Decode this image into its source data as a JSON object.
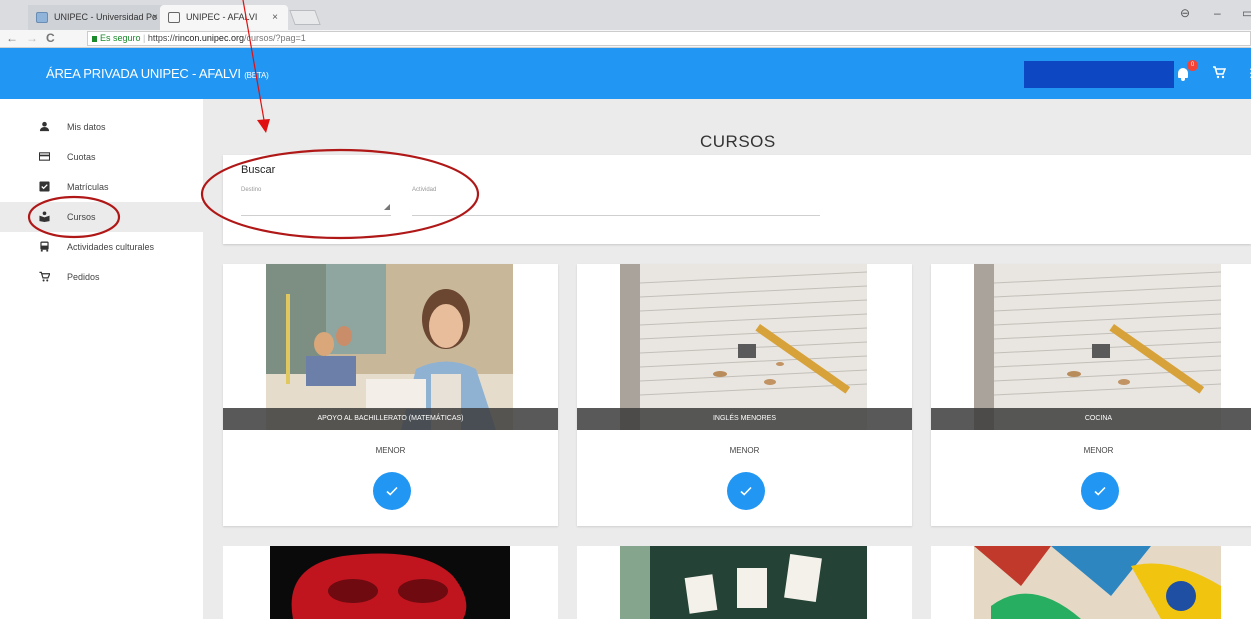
{
  "browser": {
    "tabs": [
      {
        "title": "UNIPEC - Universidad Po",
        "close": "×"
      },
      {
        "title": "UNIPEC - AFALVI",
        "close": "×"
      }
    ],
    "address": {
      "secure_label": "Es seguro",
      "scheme": "https://",
      "host": "rincon.unipec.org",
      "path": "/cursos/?pag=1"
    },
    "controls": {
      "account": "⊖",
      "minimize": "–",
      "restore": "▭"
    }
  },
  "app": {
    "title": "ÁREA PRIVADA UNIPEC - AFALVI",
    "beta": "(BETA)",
    "notification_count": "0",
    "colors": {
      "primary": "#2196f3",
      "badge": "#f44336"
    }
  },
  "sidebar": {
    "items": [
      {
        "label": "Mis datos",
        "icon": "person-icon"
      },
      {
        "label": "Cuotas",
        "icon": "credit-card-icon"
      },
      {
        "label": "Matrículas",
        "icon": "checkbox-icon"
      },
      {
        "label": "Cursos",
        "icon": "school-icon",
        "active": true
      },
      {
        "label": "Actividades culturales",
        "icon": "bus-icon"
      },
      {
        "label": "Pedidos",
        "icon": "cart-icon"
      }
    ]
  },
  "main": {
    "title": "CURSOS",
    "search": {
      "heading": "Buscar",
      "destino_label": "Destino",
      "actividad_label": "Actividad"
    },
    "courses": [
      {
        "name": "APOYO AL BACHILLERATO (MATEMÁTICAS)",
        "level": "MENOR",
        "image": "student-photo"
      },
      {
        "name": "INGLÉS MENORES",
        "level": "MENOR",
        "image": "notebook-pencil-photo"
      },
      {
        "name": "COCINA",
        "level": "MENOR",
        "image": "notebook-pencil-photo"
      }
    ]
  }
}
